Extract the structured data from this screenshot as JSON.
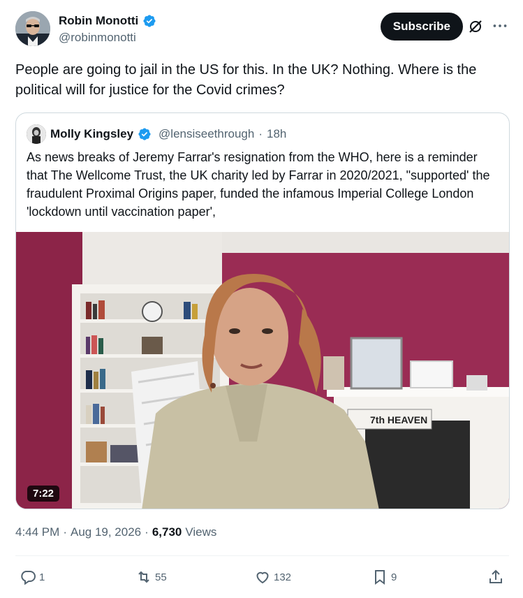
{
  "author": {
    "name": "Robin Monotti",
    "handle": "@robinmonotti"
  },
  "header": {
    "subscribe_label": "Subscribe"
  },
  "tweet": {
    "text": "People are going to jail in the US for this. In the UK? Nothing. Where is the political will for justice for the Covid crimes?"
  },
  "quote": {
    "name": "Molly Kingsley",
    "handle": "@lensiseethrough",
    "separator": "·",
    "time": "18h",
    "text": "As news breaks of Jeremy Farrar's resignation from the WHO, here is a reminder that The Wellcome Trust, the UK charity led by Farrar in 2020/2021, \"supported' the fraudulent Proximal Origins paper, funded the infamous Imperial College London 'lockdown until vaccination paper',",
    "video": {
      "duration": "7:22",
      "sign_text": "7th HEAVEN"
    }
  },
  "meta": {
    "time": "4:44 PM",
    "sep1": "·",
    "date": "Aug 19, 2026",
    "sep2": "·",
    "views_count": "6,730",
    "views_label": "Views"
  },
  "actions": {
    "replies": "1",
    "reposts": "55",
    "likes": "132",
    "bookmarks": "9"
  },
  "colors": {
    "verified": "#1d9bf0",
    "text": "#0f1419",
    "secondary": "#536471",
    "border": "#cfd9de"
  },
  "icons": [
    "verified-badge-icon",
    "grok-icon",
    "more-icon",
    "reply-icon",
    "repost-icon",
    "like-icon",
    "bookmark-icon",
    "share-icon"
  ]
}
